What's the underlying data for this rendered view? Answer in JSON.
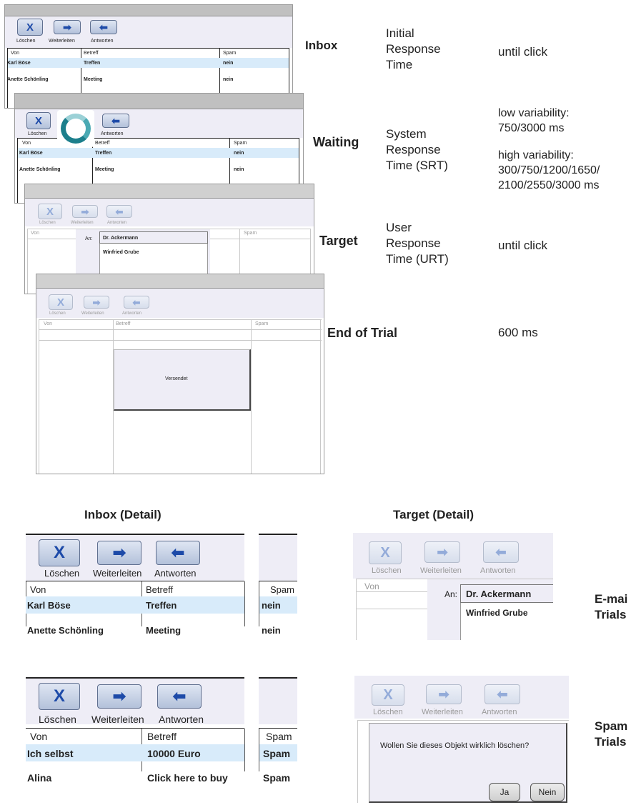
{
  "buttons": {
    "delete": "Löschen",
    "forward": "Weiterleiten",
    "reply": "Antworten"
  },
  "columns": {
    "from": "Von",
    "subject": "Betreff",
    "spam": "Spam"
  },
  "email_rows": [
    {
      "from": "Karl Böse",
      "subject": "Treffen",
      "spam": "nein"
    },
    {
      "from": "Anette Schönling",
      "subject": "Meeting",
      "spam": "nein"
    }
  ],
  "spam_rows": [
    {
      "from": "Ich selbst",
      "subject": "10000 Euro",
      "spam": "Spam"
    },
    {
      "from": "Alina",
      "subject": "Click here to buy",
      "spam": "Spam"
    }
  ],
  "recipient": {
    "label": "An:",
    "first": "Dr. Ackermann",
    "second": "Winfried Grube"
  },
  "sent_dialog": "Versendet",
  "confirm_dialog": {
    "text": "Wollen Sie dieses Objekt wirklich löschen?",
    "yes": "Ja",
    "no": "Nein"
  },
  "icons": {
    "delete": "delete-x-icon",
    "forward": "forward-arrow-icon",
    "reply": "reply-arrow-icon",
    "busy": "busy-ring-icon"
  },
  "colors": {
    "selected_row": "#d8ebfa",
    "pane": "#eeedf6",
    "title_bar": "#c0c0c0",
    "button_glyph": "#1d4aa8"
  },
  "phases": [
    {
      "name": "Inbox",
      "label": [
        "Initial",
        "Response",
        "Time"
      ],
      "timing": [
        "until click"
      ]
    },
    {
      "name": "Waiting",
      "label": [
        "System",
        "Response",
        "Time (SRT)"
      ],
      "timing": [
        "low variability:",
        "750/3000 ms",
        "high variability:",
        "300/750/1200/1650/",
        "2100/2550/3000 ms"
      ]
    },
    {
      "name": "Target",
      "label": [
        "User",
        "Response",
        "Time  (URT)"
      ],
      "timing": [
        "until click"
      ]
    },
    {
      "name": "End of Trial",
      "label": [],
      "timing": [
        "600 ms"
      ]
    }
  ],
  "detail_titles": {
    "inbox": "Inbox (Detail)",
    "target": "Target (Detail)"
  },
  "trial_types": {
    "email": [
      "E-mai",
      "Trials"
    ],
    "spam": [
      "Spam",
      "Trials"
    ]
  }
}
